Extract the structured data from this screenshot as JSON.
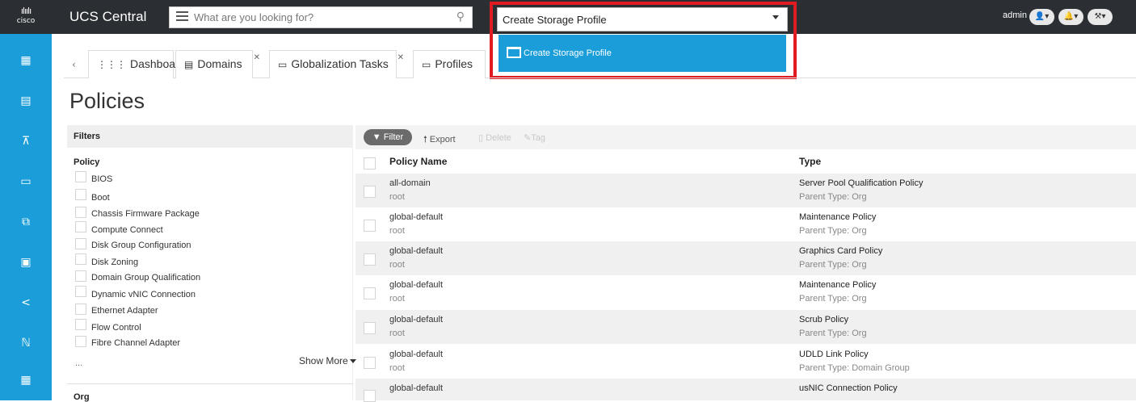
{
  "header": {
    "logo_text": "cisco",
    "app_title": "UCS Central",
    "search_placeholder": "What are you looking for?",
    "user": "admin"
  },
  "action_combo": {
    "value": "Create Storage Profile",
    "options": [
      "Create Storage Profile"
    ]
  },
  "tabs": [
    {
      "label": "Dashboard"
    },
    {
      "label": "Domains"
    },
    {
      "label": "Globalization Tasks"
    },
    {
      "label": "Profiles"
    }
  ],
  "page_title": "Policies",
  "filters": {
    "header": "Filters",
    "policy_title": "Policy",
    "items": [
      "BIOS",
      "Boot",
      "Chassis Firmware Package",
      "Compute Connect",
      "Disk Group Configuration",
      "Disk Zoning",
      "Domain Group Qualification",
      "Dynamic vNIC Connection",
      "Ethernet Adapter",
      "Flow Control",
      "Fibre Channel Adapter"
    ],
    "ellipsis": "...",
    "show_more": "Show More",
    "org_title": "Org"
  },
  "toolbar": {
    "filter": "Filter",
    "export": "Export",
    "delete": "Delete",
    "tag": "Tag"
  },
  "table": {
    "columns": [
      "Policy Name",
      "Type"
    ],
    "rows": [
      {
        "name": "all-domain",
        "sub": "root",
        "type": "Server Pool Qualification Policy",
        "type_sub": "Parent Type: Org"
      },
      {
        "name": "global-default",
        "sub": "root",
        "type": "Maintenance Policy",
        "type_sub": "Parent Type: Org"
      },
      {
        "name": "global-default",
        "sub": "root",
        "type": "Graphics Card Policy",
        "type_sub": "Parent Type: Org"
      },
      {
        "name": "global-default",
        "sub": "root",
        "type": "Maintenance Policy",
        "type_sub": "Parent Type: Org"
      },
      {
        "name": "global-default",
        "sub": "root",
        "type": "Scrub Policy",
        "type_sub": "Parent Type: Org"
      },
      {
        "name": "global-default",
        "sub": "root",
        "type": "UDLD Link Policy",
        "type_sub": "Parent Type: Domain Group"
      },
      {
        "name": "global-default",
        "sub": "",
        "type": "usNIC Connection Policy",
        "type_sub": ""
      }
    ]
  },
  "colors": {
    "topbar": "#2b2f33",
    "accent": "#1a9dd9",
    "highlight": "#e11b22"
  }
}
